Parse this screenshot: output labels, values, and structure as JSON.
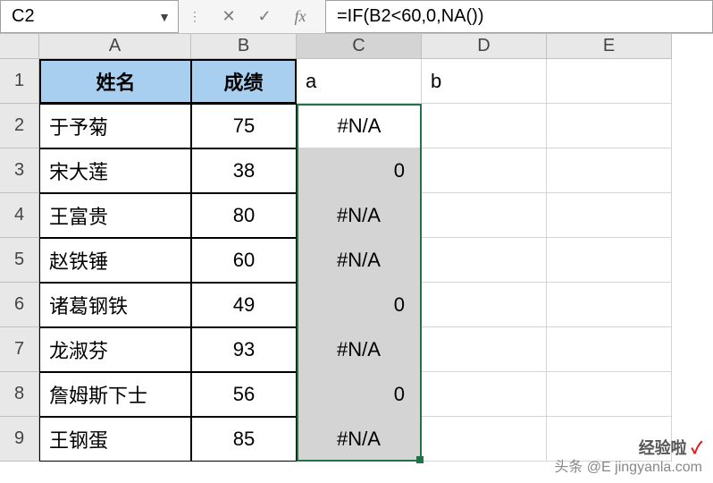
{
  "formula_bar": {
    "cell_ref": "C2",
    "fx_label": "fx",
    "formula": "=IF(B2<60,0,NA())"
  },
  "columns": [
    "A",
    "B",
    "C",
    "D",
    "E"
  ],
  "row_numbers": [
    "1",
    "2",
    "3",
    "4",
    "5",
    "6",
    "7",
    "8",
    "9"
  ],
  "headers": {
    "col_a": "姓名",
    "col_b": "成绩"
  },
  "row1_extra": {
    "c": "a",
    "d": "b"
  },
  "data_rows": [
    {
      "name": "于予菊",
      "score": "75",
      "result": "#N/A",
      "result_align": "center"
    },
    {
      "name": "宋大莲",
      "score": "38",
      "result": "0",
      "result_align": "right"
    },
    {
      "name": "王富贵",
      "score": "80",
      "result": "#N/A",
      "result_align": "center"
    },
    {
      "name": "赵铁锤",
      "score": "60",
      "result": "#N/A",
      "result_align": "center"
    },
    {
      "name": "诸葛钢铁",
      "score": "49",
      "result": "0",
      "result_align": "right"
    },
    {
      "name": "龙淑芬",
      "score": "93",
      "result": "#N/A",
      "result_align": "center"
    },
    {
      "name": "詹姆斯下士",
      "score": "56",
      "result": "0",
      "result_align": "right"
    },
    {
      "name": "王钢蛋",
      "score": "85",
      "result": "#N/A",
      "result_align": "center"
    }
  ],
  "watermark": {
    "line1": "经验啦",
    "check": "✓",
    "line2": "头条 @E",
    "line3": "jingyanla.com"
  },
  "active_cell_display": "#N/A",
  "chart_data": {
    "type": "table",
    "title": "",
    "columns": [
      "姓名",
      "成绩",
      "a"
    ],
    "rows": [
      [
        "于予菊",
        75,
        "#N/A"
      ],
      [
        "宋大莲",
        38,
        0
      ],
      [
        "王富贵",
        80,
        "#N/A"
      ],
      [
        "赵铁锤",
        60,
        "#N/A"
      ],
      [
        "诸葛钢铁",
        49,
        0
      ],
      [
        "龙淑芬",
        93,
        "#N/A"
      ],
      [
        "詹姆斯下士",
        56,
        0
      ],
      [
        "王钢蛋",
        85,
        "#N/A"
      ]
    ]
  }
}
